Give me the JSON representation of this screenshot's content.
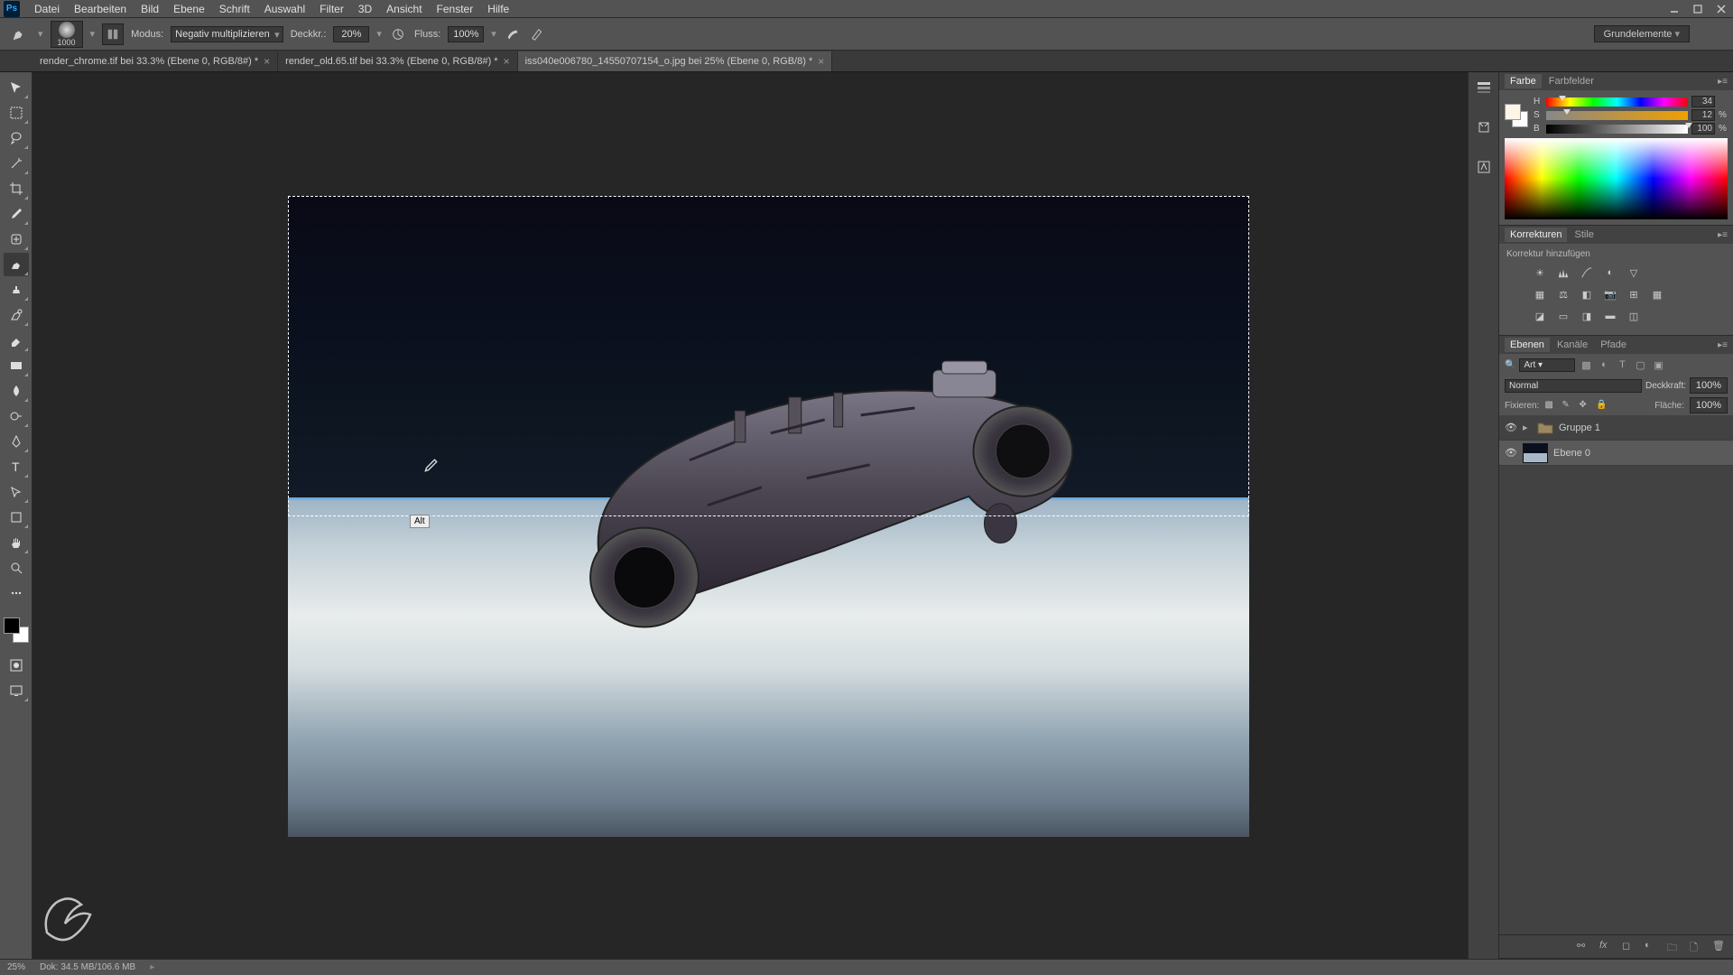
{
  "menu": {
    "items": [
      "Datei",
      "Bearbeiten",
      "Bild",
      "Ebene",
      "Schrift",
      "Auswahl",
      "Filter",
      "3D",
      "Ansicht",
      "Fenster",
      "Hilfe"
    ]
  },
  "options": {
    "brush_size": "1000",
    "mode_label": "Modus:",
    "mode_value": "Negativ multiplizieren",
    "opacity_label": "Deckkr.:",
    "opacity_value": "20%",
    "flow_label": "Fluss:",
    "flow_value": "100%",
    "workspace": "Grundelemente"
  },
  "tabs": [
    {
      "title": "render_chrome.tif bei 33.3% (Ebene 0, RGB/8#) *",
      "active": false
    },
    {
      "title": "render_old.65.tif bei 33.3% (Ebene 0, RGB/8#) *",
      "active": false
    },
    {
      "title": "iss040e006780_14550707154_o.jpg bei 25%  (Ebene 0, RGB/8) *",
      "active": true
    }
  ],
  "alt_tooltip": "Alt",
  "status": {
    "zoom": "25%",
    "doc_size": "Dok: 34.5 MB/106.6 MB"
  },
  "color_panel": {
    "tabs": [
      "Farbe",
      "Farbfelder"
    ],
    "h": {
      "label": "H",
      "value": "34",
      "thumb": 9
    },
    "s": {
      "label": "S",
      "value": "12",
      "thumb": 12,
      "pct": "%"
    },
    "b": {
      "label": "B",
      "value": "100",
      "thumb": 100,
      "pct": "%"
    }
  },
  "adjustments": {
    "tabs": [
      "Korrekturen",
      "Stile"
    ],
    "hint": "Korrektur hinzufügen"
  },
  "layers": {
    "tabs": [
      "Ebenen",
      "Kanäle",
      "Pfade"
    ],
    "filter_label": "Art",
    "blend_mode": "Normal",
    "opacity_label": "Deckkraft:",
    "opacity_value": "100%",
    "lock_label": "Fixieren:",
    "fill_label": "Fläche:",
    "fill_value": "100%",
    "items": [
      {
        "type": "group",
        "name": "Gruppe 1",
        "visible": true
      },
      {
        "type": "layer",
        "name": "Ebene 0",
        "visible": true,
        "selected": true
      }
    ]
  }
}
